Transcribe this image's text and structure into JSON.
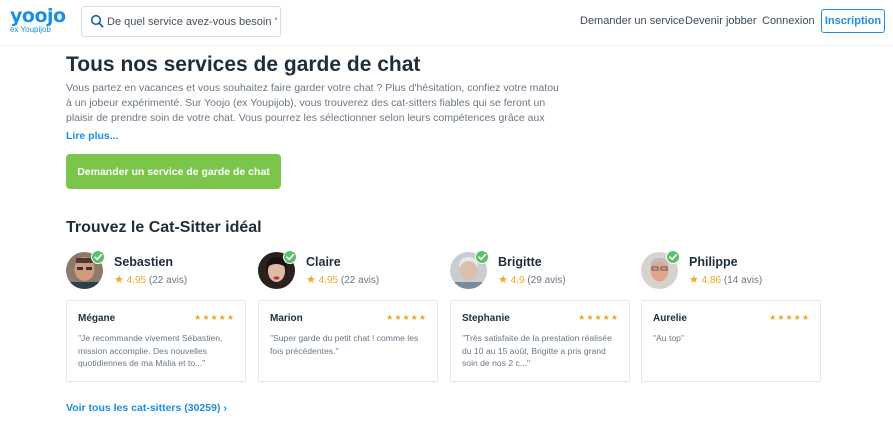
{
  "brand": {
    "logo": "yoojo",
    "tagline": "ex Youpijob",
    "accent": "#1b8ee6",
    "cta_color": "#7cc54b",
    "star_color": "#f5a623"
  },
  "search": {
    "placeholder": "De quel service avez-vous besoin ?"
  },
  "nav": {
    "demander": "Demander un service",
    "jobber": "Devenir jobber",
    "connexion": "Connexion",
    "inscription": "Inscription"
  },
  "main": {
    "title": "Tous nos services de garde de chat",
    "intro": "Vous partez en vacances et vous souhaitez faire garder votre chat ? Plus d'hésitation, confiez votre matou à un jobeur expérimenté. Sur Yoojo (ex Youpijob), vous trouverez des cat-sitters fiables qui se feront un plaisir de prendre soin de votre chat. Vous pourrez les sélectionner selon leurs compétences grâce aux évaluations des",
    "read_more": "Lire plus...",
    "cta": "Demander un service de garde de chat",
    "subtitle": "Trouvez le Cat-Sitter idéal",
    "see_all": "Voir tous les cat-sitters (30259) ›"
  },
  "sitters": [
    {
      "name": "Sebastien",
      "rating": "4,95",
      "reviews": "(22 avis)",
      "reviewer": "Mégane",
      "review_stars": "★★★★★",
      "review": "\"Je recommande vivement Sébastien, mission accomplie. Des nouvelles quotidiennes de ma Malia et to...\""
    },
    {
      "name": "Claire",
      "rating": "4,95",
      "reviews": "(22 avis)",
      "reviewer": "Marion",
      "review_stars": "★★★★★",
      "review": "\"Super garde du petit chat ! comme les fois précédentes.\""
    },
    {
      "name": "Brigitte",
      "rating": "4,9",
      "reviews": "(29 avis)",
      "reviewer": "Stephanie",
      "review_stars": "★★★★★",
      "review": "\"Très satisfaite de la prestation réalisée du 10 au 15 août, Brigitte a pris grand soin de nos 2 c...\""
    },
    {
      "name": "Philippe",
      "rating": "4,86",
      "reviews": "(14 avis)",
      "reviewer": "Aurelie",
      "review_stars": "★★★★★",
      "review": "\"Au top\""
    }
  ]
}
